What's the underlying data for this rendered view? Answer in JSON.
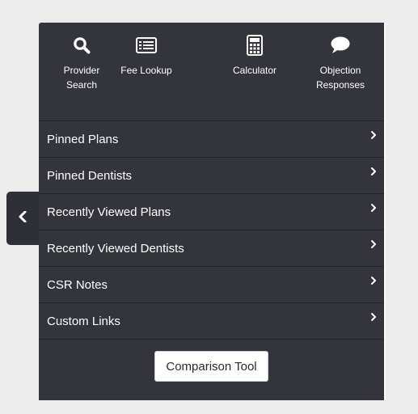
{
  "quick_links": [
    {
      "icon": "search-icon",
      "label": "Provider Search"
    },
    {
      "icon": "list-icon",
      "label": "Fee Lookup"
    },
    {
      "icon": "calculator-icon",
      "label": "Calculator"
    },
    {
      "icon": "chat-bubble-icon",
      "label": "Objection Responses"
    }
  ],
  "menu": {
    "items": [
      {
        "label": "Pinned Plans"
      },
      {
        "label": "Pinned Dentists"
      },
      {
        "label": "Recently Viewed Plans"
      },
      {
        "label": "Recently Viewed Dentists"
      },
      {
        "label": "CSR Notes"
      },
      {
        "label": "Custom Links"
      }
    ]
  },
  "comparison_tool": {
    "label": "Comparison Tool"
  },
  "colors": {
    "panel_bg": "#33343c",
    "divider": "#23242a",
    "text": "#ffffff",
    "page_bg": "#ececec"
  }
}
